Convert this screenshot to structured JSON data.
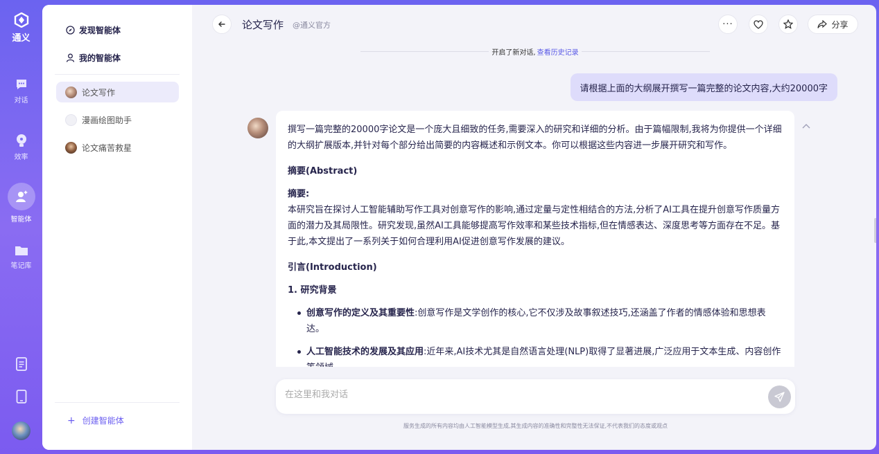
{
  "brand": {
    "name": "通义"
  },
  "rail": {
    "items": [
      {
        "label": "对话",
        "icon": "chat-icon"
      },
      {
        "label": "效率",
        "icon": "lightbulb-icon"
      },
      {
        "label": "智能体",
        "icon": "agent-icon"
      },
      {
        "label": "笔记库",
        "icon": "folder-icon"
      }
    ],
    "bottom_icons": [
      "document-icon",
      "tablet-icon",
      "user-avatar"
    ]
  },
  "sidebar": {
    "discover_label": "发现智能体",
    "mine_label": "我的智能体",
    "agents": [
      {
        "label": "论文写作"
      },
      {
        "label": "漫画绘图助手"
      },
      {
        "label": "论文痛苦救星"
      }
    ],
    "create_label": "创建智能体"
  },
  "header": {
    "title": "论文写作",
    "official_tag": "@通义官方",
    "share_label": "分享"
  },
  "conversation": {
    "started_note": "开启了新对话,",
    "history_link": "查看历史记录",
    "user_message": "请根据上面的大纲展开撰写一篇完整的论文内容,大约20000字",
    "bot": {
      "intro": "撰写一篇完整的20000字论文是一个庞大且细致的任务,需要深入的研究和详细的分析。由于篇幅限制,我将为你提供一个详细的大纲扩展版本,并针对每个部分给出简要的内容概述和示例文本。你可以根据这些内容进一步展开研究和写作。",
      "abstract_heading": "摘要(Abstract)",
      "abstract_label": "摘要:",
      "abstract_text": "本研究旨在探讨人工智能辅助写作工具对创意写作的影响,通过定量与定性相结合的方法,分析了AI工具在提升创意写作质量方面的潜力及其局限性。研究发现,虽然AI工具能够提高写作效率和某些技术指标,但在情感表达、深度思考等方面存在不足。基于此,本文提出了一系列关于如何合理利用AI促进创意写作发展的建议。",
      "intro_heading": "引言(Introduction)",
      "section_heading": "1. 研究背景",
      "bullets": [
        {
          "bold": "创意写作的定义及其重要性",
          "text": ":创意写作是文学创作的核心,它不仅涉及故事叙述技巧,还涵盖了作者的情感体验和思想表达。"
        },
        {
          "bold": "人工智能技术的发展及其应用",
          "text": ":近年来,AI技术尤其是自然语言处理(NLP)取得了显著进展,广泛应用于文本生成、内容创作等领域。"
        }
      ]
    }
  },
  "composer": {
    "placeholder": "在这里和我对话"
  },
  "footer": {
    "disclaimer": "服务生成的所有内容均由人工智能模型生成,其生成内容的准确性和完整性无法保证,不代表我们的态度或观点"
  }
}
